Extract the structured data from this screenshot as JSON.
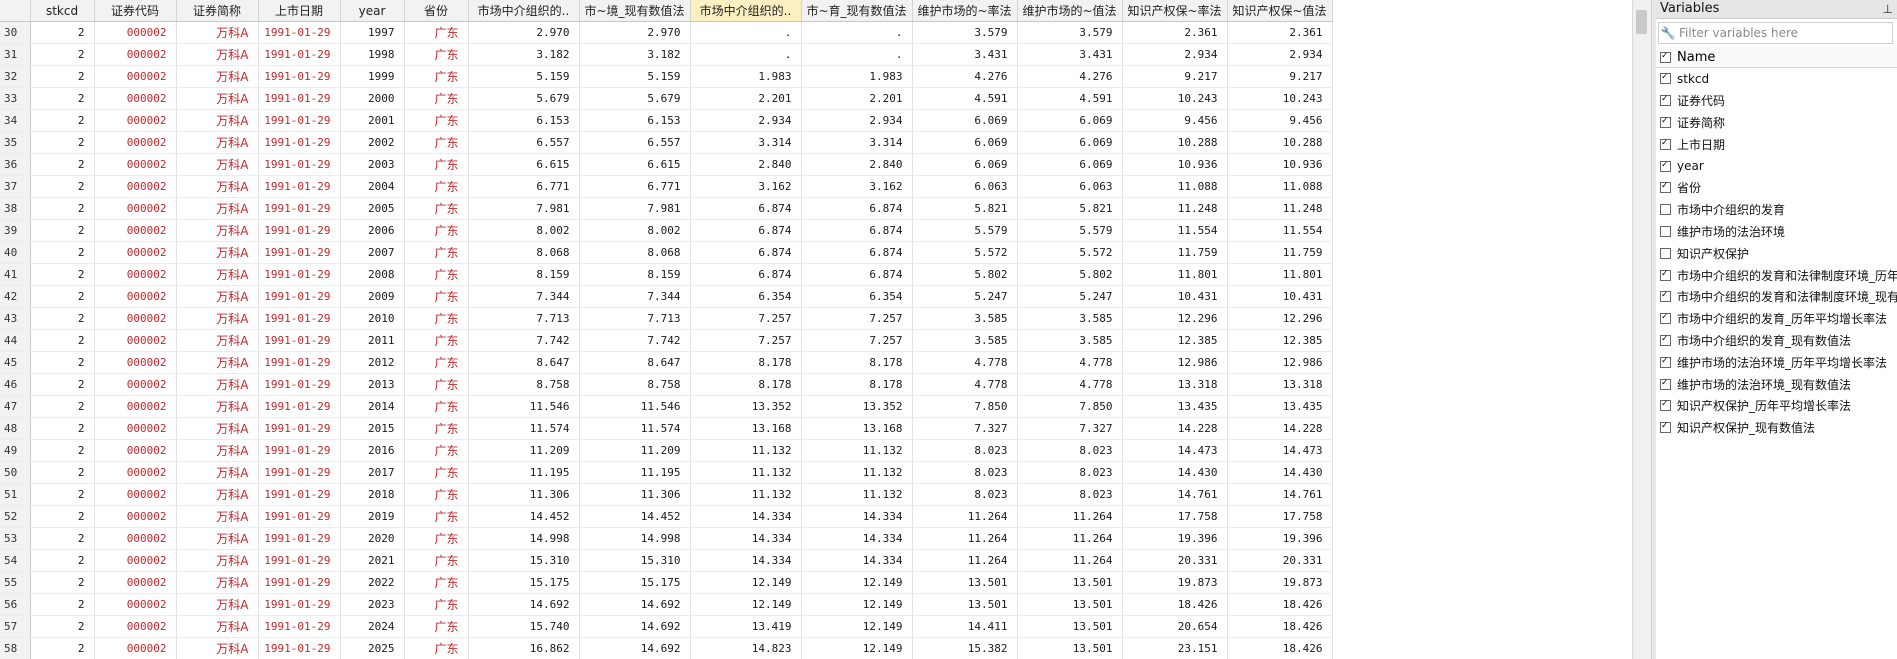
{
  "grid": {
    "columns": [
      "stkcd",
      "证券代码",
      "证券简称",
      "上市日期",
      "year",
      "省份",
      "市场中介组织的..",
      "市~境_现有数值法",
      "市场中介组织的..",
      "市~育_现有数值法",
      "维护市场的~率法",
      "维护市场的~值法",
      "知识产权保~率法",
      "知识产权保~值法"
    ],
    "selected_column_index": 8,
    "rows": [
      [
        "30",
        "2",
        "000002",
        "万科A",
        "1991-01-29",
        "1997",
        "广东",
        "2.970",
        "2.970",
        ".",
        ".",
        "3.579",
        "3.579",
        "2.361",
        "2.361"
      ],
      [
        "31",
        "2",
        "000002",
        "万科A",
        "1991-01-29",
        "1998",
        "广东",
        "3.182",
        "3.182",
        ".",
        ".",
        "3.431",
        "3.431",
        "2.934",
        "2.934"
      ],
      [
        "32",
        "2",
        "000002",
        "万科A",
        "1991-01-29",
        "1999",
        "广东",
        "5.159",
        "5.159",
        "1.983",
        "1.983",
        "4.276",
        "4.276",
        "9.217",
        "9.217"
      ],
      [
        "33",
        "2",
        "000002",
        "万科A",
        "1991-01-29",
        "2000",
        "广东",
        "5.679",
        "5.679",
        "2.201",
        "2.201",
        "4.591",
        "4.591",
        "10.243",
        "10.243"
      ],
      [
        "34",
        "2",
        "000002",
        "万科A",
        "1991-01-29",
        "2001",
        "广东",
        "6.153",
        "6.153",
        "2.934",
        "2.934",
        "6.069",
        "6.069",
        "9.456",
        "9.456"
      ],
      [
        "35",
        "2",
        "000002",
        "万科A",
        "1991-01-29",
        "2002",
        "广东",
        "6.557",
        "6.557",
        "3.314",
        "3.314",
        "6.069",
        "6.069",
        "10.288",
        "10.288"
      ],
      [
        "36",
        "2",
        "000002",
        "万科A",
        "1991-01-29",
        "2003",
        "广东",
        "6.615",
        "6.615",
        "2.840",
        "2.840",
        "6.069",
        "6.069",
        "10.936",
        "10.936"
      ],
      [
        "37",
        "2",
        "000002",
        "万科A",
        "1991-01-29",
        "2004",
        "广东",
        "6.771",
        "6.771",
        "3.162",
        "3.162",
        "6.063",
        "6.063",
        "11.088",
        "11.088"
      ],
      [
        "38",
        "2",
        "000002",
        "万科A",
        "1991-01-29",
        "2005",
        "广东",
        "7.981",
        "7.981",
        "6.874",
        "6.874",
        "5.821",
        "5.821",
        "11.248",
        "11.248"
      ],
      [
        "39",
        "2",
        "000002",
        "万科A",
        "1991-01-29",
        "2006",
        "广东",
        "8.002",
        "8.002",
        "6.874",
        "6.874",
        "5.579",
        "5.579",
        "11.554",
        "11.554"
      ],
      [
        "40",
        "2",
        "000002",
        "万科A",
        "1991-01-29",
        "2007",
        "广东",
        "8.068",
        "8.068",
        "6.874",
        "6.874",
        "5.572",
        "5.572",
        "11.759",
        "11.759"
      ],
      [
        "41",
        "2",
        "000002",
        "万科A",
        "1991-01-29",
        "2008",
        "广东",
        "8.159",
        "8.159",
        "6.874",
        "6.874",
        "5.802",
        "5.802",
        "11.801",
        "11.801"
      ],
      [
        "42",
        "2",
        "000002",
        "万科A",
        "1991-01-29",
        "2009",
        "广东",
        "7.344",
        "7.344",
        "6.354",
        "6.354",
        "5.247",
        "5.247",
        "10.431",
        "10.431"
      ],
      [
        "43",
        "2",
        "000002",
        "万科A",
        "1991-01-29",
        "2010",
        "广东",
        "7.713",
        "7.713",
        "7.257",
        "7.257",
        "3.585",
        "3.585",
        "12.296",
        "12.296"
      ],
      [
        "44",
        "2",
        "000002",
        "万科A",
        "1991-01-29",
        "2011",
        "广东",
        "7.742",
        "7.742",
        "7.257",
        "7.257",
        "3.585",
        "3.585",
        "12.385",
        "12.385"
      ],
      [
        "45",
        "2",
        "000002",
        "万科A",
        "1991-01-29",
        "2012",
        "广东",
        "8.647",
        "8.647",
        "8.178",
        "8.178",
        "4.778",
        "4.778",
        "12.986",
        "12.986"
      ],
      [
        "46",
        "2",
        "000002",
        "万科A",
        "1991-01-29",
        "2013",
        "广东",
        "8.758",
        "8.758",
        "8.178",
        "8.178",
        "4.778",
        "4.778",
        "13.318",
        "13.318"
      ],
      [
        "47",
        "2",
        "000002",
        "万科A",
        "1991-01-29",
        "2014",
        "广东",
        "11.546",
        "11.546",
        "13.352",
        "13.352",
        "7.850",
        "7.850",
        "13.435",
        "13.435"
      ],
      [
        "48",
        "2",
        "000002",
        "万科A",
        "1991-01-29",
        "2015",
        "广东",
        "11.574",
        "11.574",
        "13.168",
        "13.168",
        "7.327",
        "7.327",
        "14.228",
        "14.228"
      ],
      [
        "49",
        "2",
        "000002",
        "万科A",
        "1991-01-29",
        "2016",
        "广东",
        "11.209",
        "11.209",
        "11.132",
        "11.132",
        "8.023",
        "8.023",
        "14.473",
        "14.473"
      ],
      [
        "50",
        "2",
        "000002",
        "万科A",
        "1991-01-29",
        "2017",
        "广东",
        "11.195",
        "11.195",
        "11.132",
        "11.132",
        "8.023",
        "8.023",
        "14.430",
        "14.430"
      ],
      [
        "51",
        "2",
        "000002",
        "万科A",
        "1991-01-29",
        "2018",
        "广东",
        "11.306",
        "11.306",
        "11.132",
        "11.132",
        "8.023",
        "8.023",
        "14.761",
        "14.761"
      ],
      [
        "52",
        "2",
        "000002",
        "万科A",
        "1991-01-29",
        "2019",
        "广东",
        "14.452",
        "14.452",
        "14.334",
        "14.334",
        "11.264",
        "11.264",
        "17.758",
        "17.758"
      ],
      [
        "53",
        "2",
        "000002",
        "万科A",
        "1991-01-29",
        "2020",
        "广东",
        "14.998",
        "14.998",
        "14.334",
        "14.334",
        "11.264",
        "11.264",
        "19.396",
        "19.396"
      ],
      [
        "54",
        "2",
        "000002",
        "万科A",
        "1991-01-29",
        "2021",
        "广东",
        "15.310",
        "15.310",
        "14.334",
        "14.334",
        "11.264",
        "11.264",
        "20.331",
        "20.331"
      ],
      [
        "55",
        "2",
        "000002",
        "万科A",
        "1991-01-29",
        "2022",
        "广东",
        "15.175",
        "15.175",
        "12.149",
        "12.149",
        "13.501",
        "13.501",
        "19.873",
        "19.873"
      ],
      [
        "56",
        "2",
        "000002",
        "万科A",
        "1991-01-29",
        "2023",
        "广东",
        "14.692",
        "14.692",
        "12.149",
        "12.149",
        "13.501",
        "13.501",
        "18.426",
        "18.426"
      ],
      [
        "57",
        "2",
        "000002",
        "万科A",
        "1991-01-29",
        "2024",
        "广东",
        "15.740",
        "14.692",
        "13.419",
        "12.149",
        "14.411",
        "13.501",
        "20.654",
        "18.426"
      ],
      [
        "58",
        "2",
        "000002",
        "万科A",
        "1991-01-29",
        "2025",
        "广东",
        "16.862",
        "14.692",
        "14.823",
        "12.149",
        "15.382",
        "13.501",
        "23.151",
        "18.426"
      ]
    ]
  },
  "variables_panel": {
    "title": "Variables",
    "pin_icon": "pin-icon",
    "filter_icon": "wrench-icon",
    "filter_placeholder": "Filter variables here",
    "name_header": "Name",
    "items": [
      {
        "name": "stkcd",
        "checked": true
      },
      {
        "name": "证券代码",
        "checked": true
      },
      {
        "name": "证券简称",
        "checked": true
      },
      {
        "name": "上市日期",
        "checked": true
      },
      {
        "name": "year",
        "checked": true
      },
      {
        "name": "省份",
        "checked": true
      },
      {
        "name": "市场中介组织的发育",
        "checked": false
      },
      {
        "name": "维护市场的法治环境",
        "checked": false
      },
      {
        "name": "知识产权保护",
        "checked": false
      },
      {
        "name": "市场中介组织的发育和法律制度环境_历年",
        "checked": true
      },
      {
        "name": "市场中介组织的发育和法律制度环境_现有",
        "checked": true
      },
      {
        "name": "市场中介组织的发育_历年平均增长率法",
        "checked": true
      },
      {
        "name": "市场中介组织的发育_现有数值法",
        "checked": true
      },
      {
        "name": "维护市场的法治环境_历年平均增长率法",
        "checked": true
      },
      {
        "name": "维护市场的法治环境_现有数值法",
        "checked": true
      },
      {
        "name": "知识产权保护_历年平均增长率法",
        "checked": true
      },
      {
        "name": "知识产权保护_现有数值法",
        "checked": true
      }
    ]
  }
}
